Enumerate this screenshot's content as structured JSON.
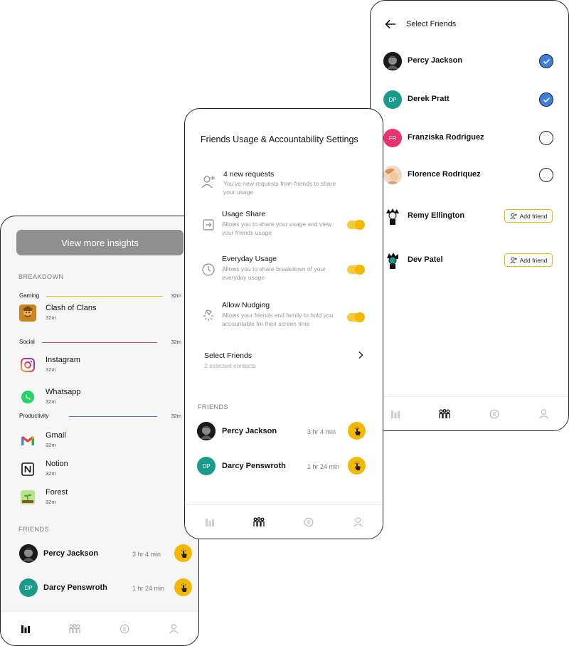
{
  "colors": {
    "accent_yellow": "#f5b800",
    "check_blue": "#3d7fe0",
    "teal_avatar": "#1a9a8a",
    "pink_avatar": "#e8336d",
    "gaming_line": "#f2c218",
    "social_line": "#e04848",
    "productivity_line": "#3b7fd6"
  },
  "left_screen": {
    "insights_button": "View more insights",
    "breakdown_label": "BREAKDOWN",
    "categories": [
      {
        "name": "Gaming",
        "time": "32m",
        "color": "#f2c218"
      },
      {
        "name": "Social",
        "time": "32m",
        "color": "#e04848"
      },
      {
        "name": "Productivity",
        "time": "32m",
        "color": "#3b7fd6"
      }
    ],
    "apps": [
      {
        "name": "Clash of Clans",
        "time": "32m",
        "icon": "clash-of-clans-icon"
      },
      {
        "name": "Instagram",
        "time": "32m",
        "icon": "instagram-icon"
      },
      {
        "name": "Whatsapp",
        "time": "32m",
        "icon": "whatsapp-icon"
      },
      {
        "name": "Gmail",
        "time": "32m",
        "icon": "gmail-icon"
      },
      {
        "name": "Notion",
        "time": "32m",
        "icon": "notion-icon"
      },
      {
        "name": "Forest",
        "time": "32m",
        "icon": "forest-icon"
      }
    ],
    "friends_label": "FRIENDS",
    "friends": [
      {
        "name": "Percy Jackson",
        "time": "3 hr 4 min",
        "initials": ""
      },
      {
        "name": "Darcy Penswroth",
        "time": "1 hr 24 min",
        "initials": "DP"
      }
    ]
  },
  "middle_screen": {
    "title": "Friends Usage & Accountability Settings",
    "requests_title": "4 new requests",
    "requests_desc": "You've new requests from friends to share your usage",
    "settings": [
      {
        "title": "Usage Share",
        "desc": "Allows you to share your usage and view your friends usage",
        "enabled": true
      },
      {
        "title": "Everyday Usage",
        "desc": "Allows you to share breakdown of your everyday usage",
        "enabled": true
      },
      {
        "title": "Allow Nudging",
        "desc": "Allows your friends and family to hold you accountable for their screen time",
        "enabled": true
      }
    ],
    "select_friends_title": "Select Friends",
    "select_friends_sub": "2 selected contacts",
    "friends_label": "FRIENDS",
    "friends": [
      {
        "name": "Percy Jackson",
        "time": "3 hr 4 min",
        "initials": ""
      },
      {
        "name": "Darcy Penswroth",
        "time": "1 hr 24 min",
        "initials": "DP"
      }
    ]
  },
  "right_screen": {
    "title": "Select Friends",
    "contacts": [
      {
        "name": "Percy Jackson",
        "initials": "",
        "state": "checked"
      },
      {
        "name": "Derek Pratt",
        "initials": "DP",
        "state": "checked"
      },
      {
        "name": "Franziska Rodriguez",
        "initials": "FR",
        "state": "unchecked"
      },
      {
        "name": "Florence Rodriquez",
        "initials": "",
        "state": "unchecked"
      },
      {
        "name": "Remy Ellington",
        "initials": "",
        "state": "add"
      },
      {
        "name": "Dev Patel",
        "initials": "",
        "state": "add"
      }
    ],
    "add_friend_label": "Add friend"
  }
}
